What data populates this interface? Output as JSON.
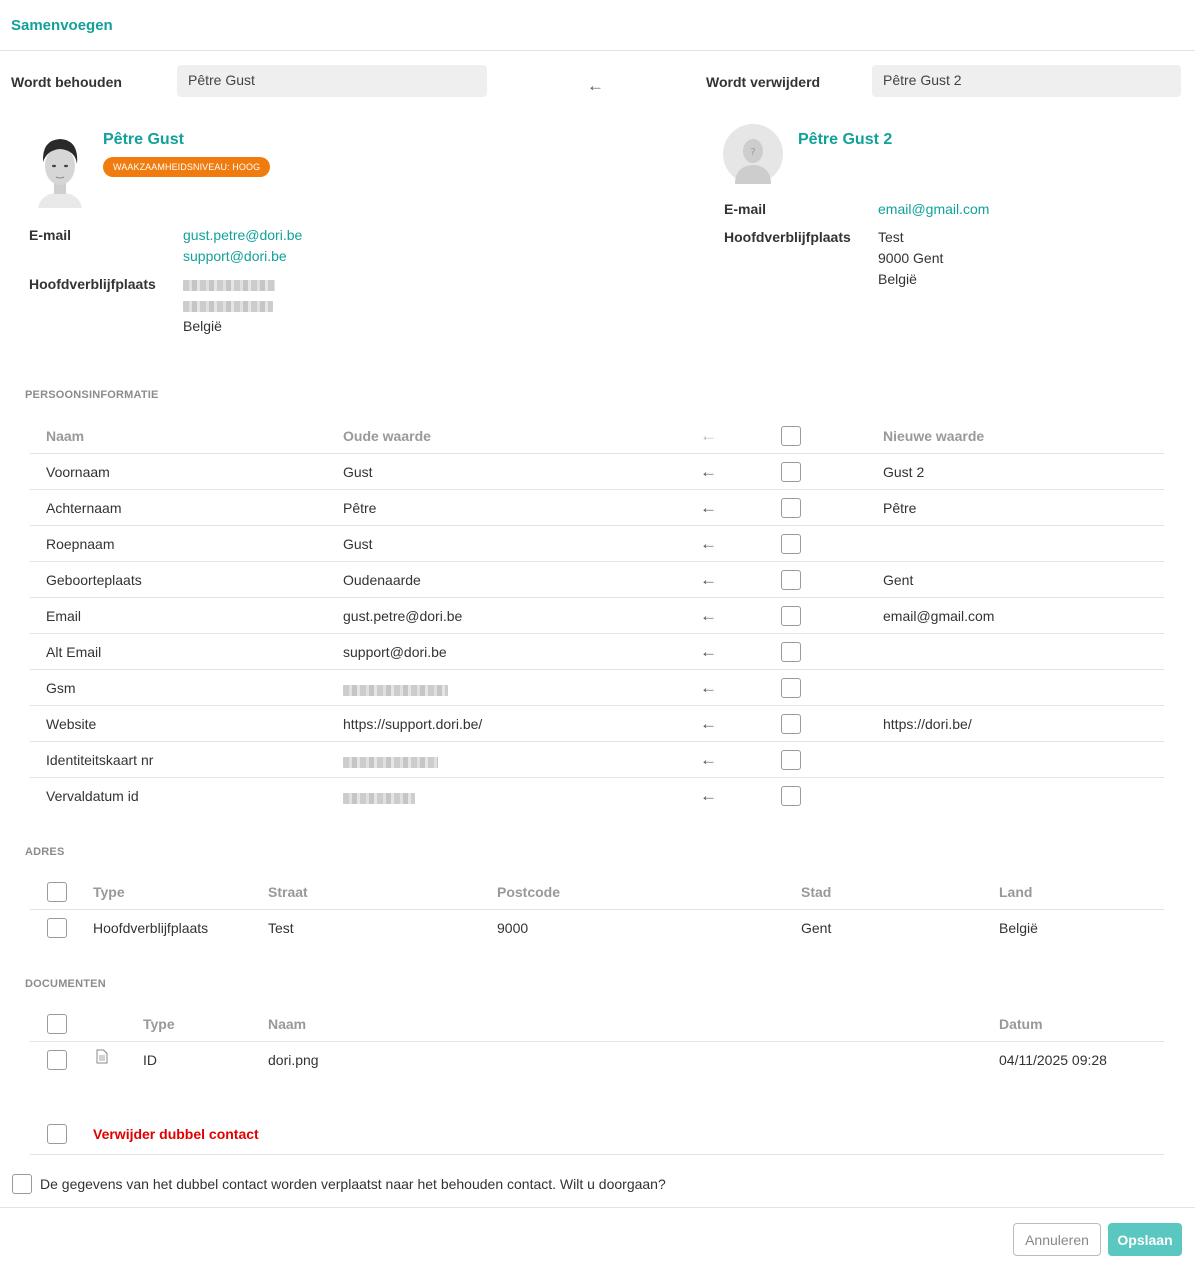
{
  "dialog": {
    "title": "Samenvoegen"
  },
  "keep": {
    "label": "Wordt behouden",
    "value": "Pêtre Gust"
  },
  "remove": {
    "label": "Wordt verwijderd",
    "value": "Pêtre Gust 2"
  },
  "left_contact": {
    "name": "Pêtre Gust",
    "badge": "WAAKZAAMHEIDSNIVEAU: HOOG",
    "email_label": "E-mail",
    "emails": [
      "gust.petre@dori.be",
      "support@dori.be"
    ],
    "address_label": "Hoofdverblijfplaats",
    "country": "België"
  },
  "right_contact": {
    "name": "Pêtre Gust 2",
    "email_label": "E-mail",
    "email": "email@gmail.com",
    "address_label": "Hoofdverblijfplaats",
    "address_lines": [
      "Test",
      "9000 Gent",
      "België"
    ]
  },
  "persons": {
    "section": "PERSOONSINFORMATIE",
    "headers": {
      "name": "Naam",
      "old": "Oude waarde",
      "new": "Nieuwe waarde"
    },
    "rows": [
      {
        "name": "Voornaam",
        "old": "Gust",
        "new": "Gust 2"
      },
      {
        "name": "Achternaam",
        "old": "Pêtre",
        "new": "Pêtre"
      },
      {
        "name": "Roepnaam",
        "old": "Gust",
        "new": ""
      },
      {
        "name": "Geboorteplaats",
        "old": "Oudenaarde",
        "new": "Gent"
      },
      {
        "name": "Email",
        "old": "gust.petre@dori.be",
        "new": "email@gmail.com"
      },
      {
        "name": "Alt Email",
        "old": "support@dori.be",
        "new": ""
      },
      {
        "name": "Gsm",
        "old": "",
        "new": ""
      },
      {
        "name": "Website",
        "old": "https://support.dori.be/",
        "new": "https://dori.be/"
      },
      {
        "name": "Identiteitskaart nr",
        "old": "",
        "new": ""
      },
      {
        "name": "Vervaldatum id",
        "old": "",
        "new": ""
      }
    ]
  },
  "address": {
    "section": "ADRES",
    "headers": {
      "type": "Type",
      "street": "Straat",
      "postcode": "Postcode",
      "city": "Stad",
      "country": "Land"
    },
    "rows": [
      {
        "type": "Hoofdverblijfplaats",
        "street": "Test",
        "postcode": "9000",
        "city": "Gent",
        "country": "België"
      }
    ]
  },
  "documents": {
    "section": "DOCUMENTEN",
    "headers": {
      "type": "Type",
      "name": "Naam",
      "date": "Datum"
    },
    "rows": [
      {
        "type": "ID",
        "name": "dori.png",
        "date": "04/11/2025 09:28"
      }
    ]
  },
  "delete_label": "Verwijder dubbel contact",
  "confirm_text": "De gegevens van het dubbel contact worden verplaatst naar het behouden contact. Wilt u doorgaan?",
  "buttons": {
    "cancel": "Annuleren",
    "save": "Opslaan"
  },
  "colors": {
    "accent": "#12a19a",
    "badge": "#f07c10",
    "danger": "#e00000",
    "save_button": "#5ac7c0"
  },
  "icons": {
    "arrow": "arrow-left-icon",
    "document": "document-icon",
    "avatar_placeholder": "person-silhouette-icon"
  }
}
